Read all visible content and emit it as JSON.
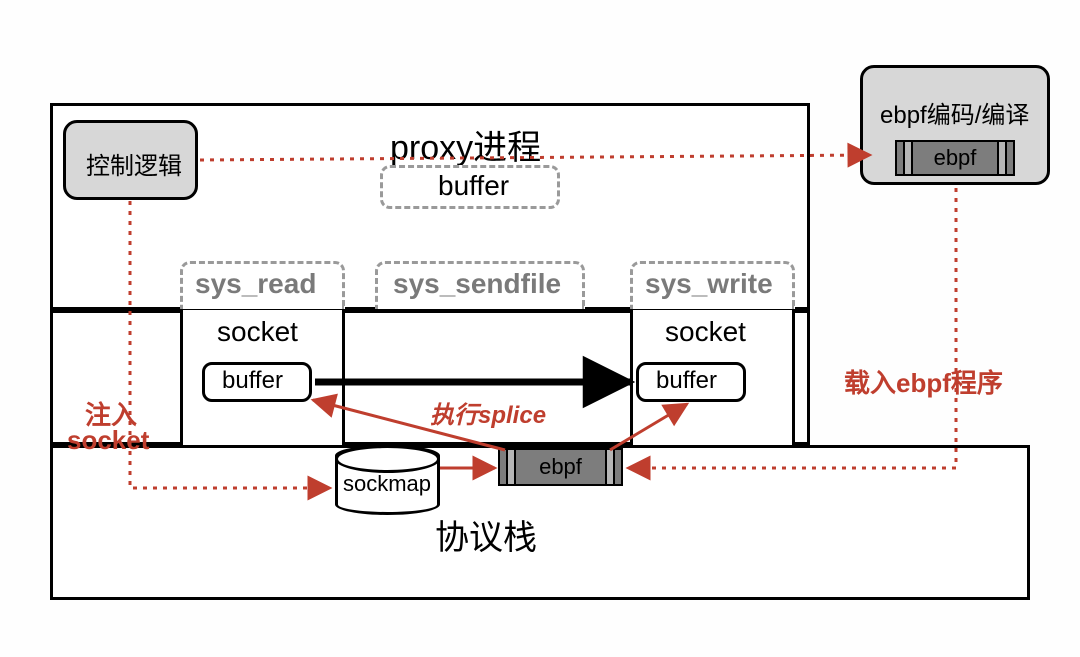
{
  "proxy_title": "proxy进程",
  "control_logic": "控制逻辑",
  "ebpf_compile": "ebpf编码/编译",
  "ebpf_label": "ebpf",
  "ebpf_label2": "ebpf",
  "buffer_top": "buffer",
  "sys_read": "sys_read",
  "sys_sendfile": "sys_sendfile",
  "sys_write": "sys_write",
  "socket_left": "socket",
  "socket_right": "socket",
  "buffer_left": "buffer",
  "buffer_right": "buffer",
  "exec_splice": "执行splice",
  "sockmap": "sockmap",
  "protocol_stack": "协议栈",
  "inject_socket_l1": "注入",
  "inject_socket_l2": "socket",
  "load_ebpf_prog": "载入ebpf程序"
}
